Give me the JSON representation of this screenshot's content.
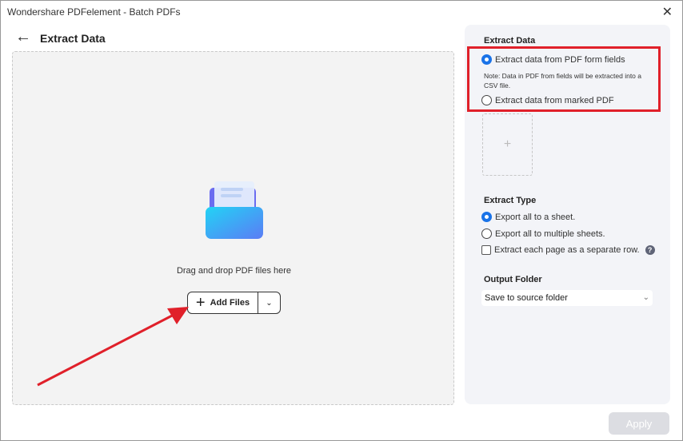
{
  "window": {
    "title": "Wondershare PDFelement - Batch PDFs",
    "close": "✕"
  },
  "header": {
    "back": "←",
    "title": "Extract Data"
  },
  "dropzone": {
    "text": "Drag and drop PDF files here",
    "add_files": "Add Files",
    "plus": "+",
    "chevron": "⌄"
  },
  "panel": {
    "extract_data": {
      "heading": "Extract Data",
      "opt1": "Extract data from PDF form fields",
      "note": "Note: Data in PDF from fields will be extracted into a CSV file.",
      "opt2": "Extract data from marked PDF",
      "selected": "opt1",
      "add": "+"
    },
    "extract_type": {
      "heading": "Extract Type",
      "opt1": "Export all to a sheet.",
      "opt2": "Export all to multiple sheets.",
      "checkbox": "Extract each page as a separate row.",
      "checked": false,
      "help": "?"
    },
    "output": {
      "heading": "Output Folder",
      "value": "Save to source folder",
      "chevron": "⌄"
    }
  },
  "apply": "Apply",
  "colors": {
    "accent": "#1a73e8",
    "highlight": "#e0202a"
  }
}
